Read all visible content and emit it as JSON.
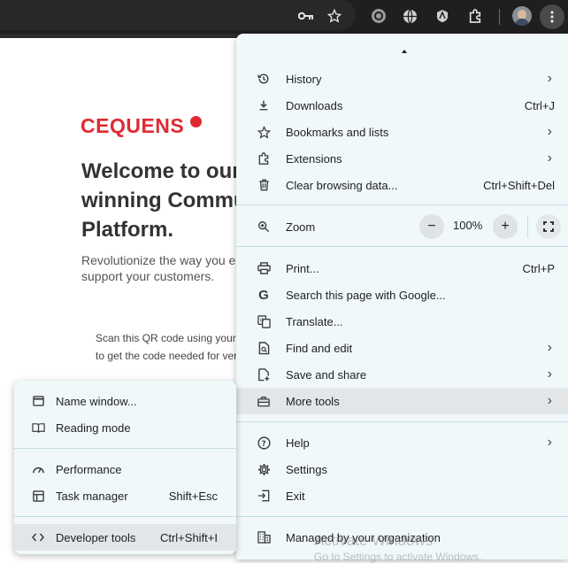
{
  "page": {
    "logo": "CEQUENS",
    "heading_lines": [
      "Welcome to our",
      "winning Commu",
      "Platform."
    ],
    "subtitle_lines": [
      "Revolutionize the way you e",
      "support your customers."
    ],
    "scan_lines": [
      "Scan this QR code using your a",
      "to get the code needed for ver"
    ]
  },
  "main_menu": {
    "items": [
      {
        "label": "History",
        "icon": "history-icon",
        "submenu": true
      },
      {
        "label": "Downloads",
        "icon": "download-icon",
        "shortcut": "Ctrl+J"
      },
      {
        "label": "Bookmarks and lists",
        "icon": "star-icon",
        "submenu": true
      },
      {
        "label": "Extensions",
        "icon": "puzzle-icon",
        "submenu": true
      },
      {
        "label": "Clear browsing data...",
        "icon": "trash-icon",
        "shortcut": "Ctrl+Shift+Del"
      }
    ],
    "zoom": {
      "label": "Zoom",
      "minus": "−",
      "value": "100%",
      "plus": "+"
    },
    "items2": [
      {
        "label": "Print...",
        "shortcut": "Ctrl+P"
      },
      {
        "label": "Search this page with Google..."
      },
      {
        "label": "Translate..."
      },
      {
        "label": "Find and edit",
        "submenu": true
      },
      {
        "label": "Save and share",
        "submenu": true
      },
      {
        "label": "More tools",
        "submenu": true
      }
    ],
    "items3": [
      {
        "label": "Help",
        "submenu": true
      },
      {
        "label": "Settings"
      },
      {
        "label": "Exit"
      }
    ],
    "managed": "Managed by your organization"
  },
  "sub_menu": {
    "items": [
      {
        "label": "Name window..."
      },
      {
        "label": "Reading mode"
      },
      {
        "label": "Performance"
      },
      {
        "label": "Task manager",
        "shortcut": "Shift+Esc"
      },
      {
        "label": "Developer tools",
        "shortcut": "Ctrl+Shift+I"
      }
    ]
  },
  "watermark": {
    "line1": "Activate Windows",
    "line2": "Go to Settings to activate Windows."
  },
  "colors": {
    "brand": "#e02a32",
    "menu_bg": "#f0f8fa",
    "highlight": "#e2e6e8"
  }
}
